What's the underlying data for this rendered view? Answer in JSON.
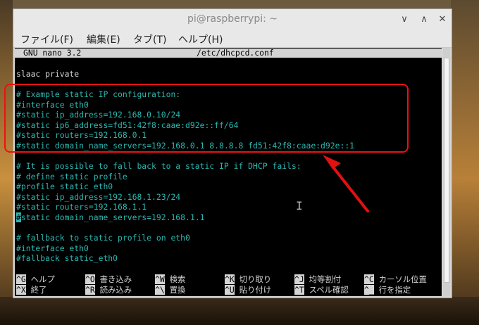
{
  "window": {
    "title": "pi@raspberrypi: ~",
    "minimize": "∨",
    "maximize": "∧",
    "close": "✕"
  },
  "menu": [
    {
      "label": "ファイル(F)"
    },
    {
      "label": "編集(E)"
    },
    {
      "label": "タブ(T)"
    },
    {
      "label": "ヘルプ(H)"
    }
  ],
  "nano": {
    "version": "GNU nano 3.2",
    "filename": "/etc/dhcpcd.conf"
  },
  "lines": [
    "slaac private",
    "",
    "# Example static IP configuration:",
    "#interface eth0",
    "#static ip_address=192.168.0.10/24",
    "#static ip6_address=fd51:42f8:caae:d92e::ff/64",
    "#static routers=192.168.0.1",
    "#static domain_name_servers=192.168.0.1 8.8.8.8 fd51:42f8:caae:d92e::1",
    "",
    "# It is possible to fall back to a static IP if DHCP fails:",
    "# define static profile",
    "#profile static_eth0",
    "#static ip_address=192.168.1.23/24",
    "#static routers=192.168.1.1",
    "static domain_name_servers=192.168.1.1",
    "",
    "# fallback to static profile on eth0",
    "#interface eth0",
    "#fallback static_eth0"
  ],
  "cursor_char": "#",
  "shortcuts_row1": [
    {
      "key": "^G",
      "label": "ヘルプ"
    },
    {
      "key": "^O",
      "label": "書き込み"
    },
    {
      "key": "^W",
      "label": "検索"
    },
    {
      "key": "^K",
      "label": "切り取り"
    },
    {
      "key": "^J",
      "label": "均等割付"
    },
    {
      "key": "^C",
      "label": "カーソル位置"
    }
  ],
  "shortcuts_row2": [
    {
      "key": "^X",
      "label": "終了"
    },
    {
      "key": "^R",
      "label": "読み込み"
    },
    {
      "key": "^\\",
      "label": "置換"
    },
    {
      "key": "^U",
      "label": "貼り付け"
    },
    {
      "key": "^T",
      "label": "スペル確認"
    },
    {
      "key": "^_",
      "label": "行を指定"
    }
  ],
  "colors": {
    "annotation": "#e11111",
    "comment": "#2bb7b0"
  }
}
